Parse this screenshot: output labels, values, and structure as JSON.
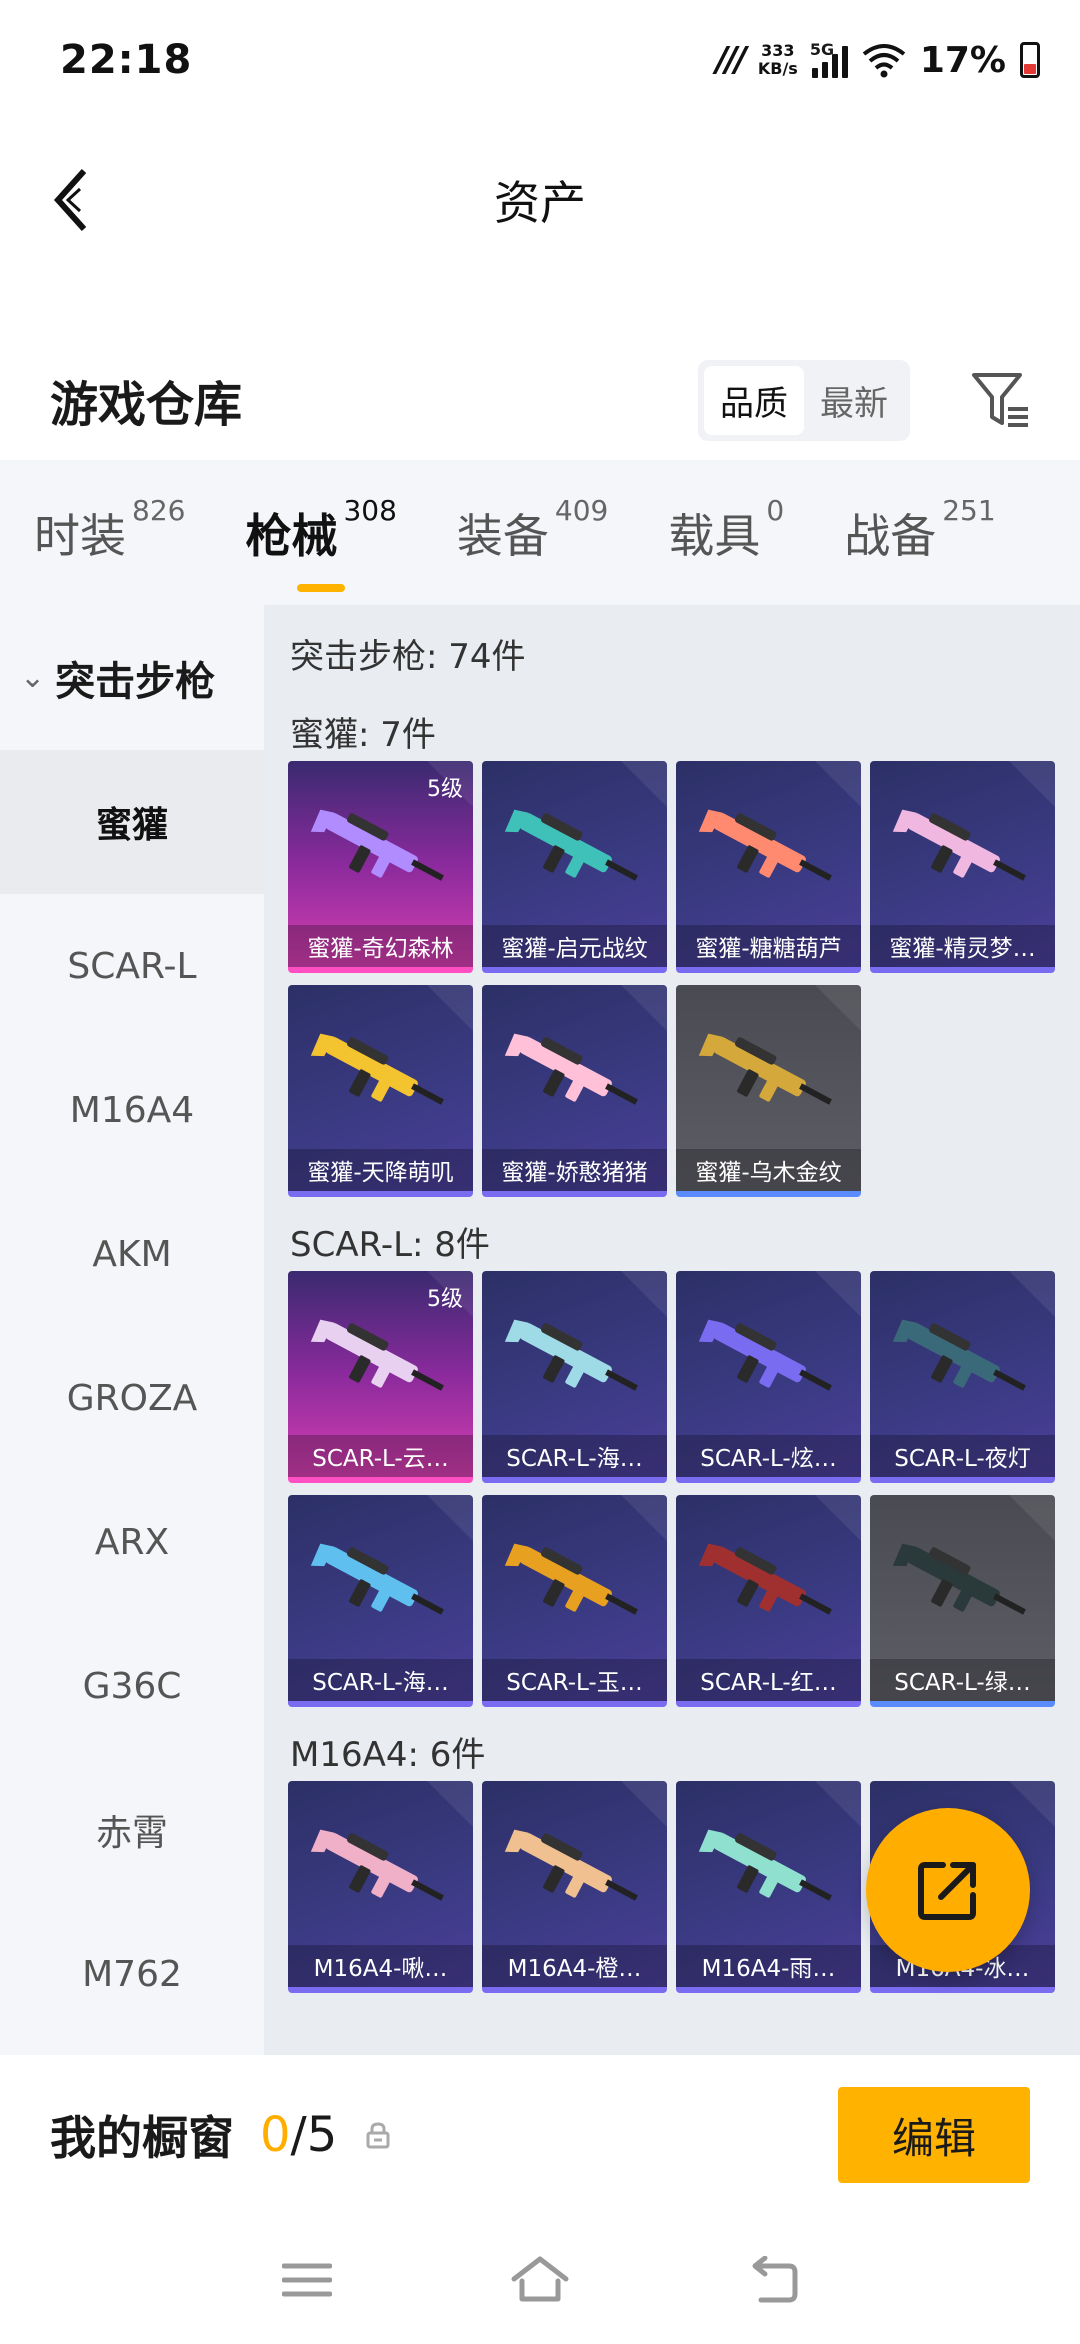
{
  "status_bar": {
    "time": "22:18",
    "net_speed_value": "333",
    "net_speed_unit": "KB/s",
    "network_type": "5G",
    "battery": "17%"
  },
  "header": {
    "title": "资产"
  },
  "warehouse": {
    "title": "游戏仓库",
    "sort_options": [
      "品质",
      "最新"
    ],
    "active_sort": "品质"
  },
  "category_tabs": [
    {
      "label": "时装",
      "count": "826"
    },
    {
      "label": "枪械",
      "count": "308"
    },
    {
      "label": "装备",
      "count": "409"
    },
    {
      "label": "载具",
      "count": "0"
    },
    {
      "label": "战备",
      "count": "251"
    }
  ],
  "sidebar": {
    "group": "突击步枪",
    "items": [
      "蜜獾",
      "SCAR-L",
      "M16A4",
      "AKM",
      "GROZA",
      "ARX",
      "G36C",
      "赤霄",
      "M762"
    ]
  },
  "main": {
    "total": "突击步枪: 74件",
    "sections": [
      {
        "title": "蜜獾: 7件",
        "items": [
          {
            "name": "蜜獾-奇幻森林",
            "level": "5级",
            "rarity": "pink",
            "color": "#b08cff"
          },
          {
            "name": "蜜獾-启元战纹",
            "level": "",
            "rarity": "purple",
            "color": "#3fc0b8"
          },
          {
            "name": "蜜獾-糖糖葫芦",
            "level": "",
            "rarity": "purple",
            "color": "#ff8a70"
          },
          {
            "name": "蜜獾-精灵梦…",
            "level": "",
            "rarity": "purple",
            "color": "#f0b8e0"
          },
          {
            "name": "蜜獾-天降萌叽",
            "level": "",
            "rarity": "purple",
            "color": "#f4c430"
          },
          {
            "name": "蜜獾-娇憨猪猪",
            "level": "",
            "rarity": "purple",
            "color": "#ffc0d8"
          },
          {
            "name": "蜜獾-乌木金纹",
            "level": "",
            "rarity": "grey",
            "color": "#d4a83a"
          }
        ]
      },
      {
        "title": "SCAR-L: 8件",
        "items": [
          {
            "name": "SCAR-L-云…",
            "level": "5级",
            "rarity": "pink",
            "color": "#e8d0f0"
          },
          {
            "name": "SCAR-L-海…",
            "level": "",
            "rarity": "purple",
            "color": "#9fdbe6"
          },
          {
            "name": "SCAR-L-炫…",
            "level": "",
            "rarity": "purple",
            "color": "#7a6cf0"
          },
          {
            "name": "SCAR-L-夜灯",
            "level": "",
            "rarity": "purple",
            "color": "#3a6a7a"
          },
          {
            "name": "SCAR-L-海…",
            "level": "",
            "rarity": "purple",
            "color": "#5fc0f0"
          },
          {
            "name": "SCAR-L-玉…",
            "level": "",
            "rarity": "purple",
            "color": "#e8a020"
          },
          {
            "name": "SCAR-L-红…",
            "level": "",
            "rarity": "purple",
            "color": "#a03030"
          },
          {
            "name": "SCAR-L-绿…",
            "level": "",
            "rarity": "grey",
            "color": "#2a3a3a"
          }
        ]
      },
      {
        "title": "M16A4: 6件",
        "items": [
          {
            "name": "M16A4-啾…",
            "level": "",
            "rarity": "purple",
            "color": "#f0b0c8"
          },
          {
            "name": "M16A4-橙…",
            "level": "",
            "rarity": "purple",
            "color": "#f0c090"
          },
          {
            "name": "M16A4-雨…",
            "level": "",
            "rarity": "purple",
            "color": "#90e0d0"
          },
          {
            "name": "M16A4-冰…",
            "level": "",
            "rarity": "purple",
            "color": "#3a80ff"
          }
        ]
      }
    ]
  },
  "showcase": {
    "label": "我的橱窗",
    "current": "0",
    "total": "/5",
    "edit_label": "编辑"
  },
  "colors": {
    "accent": "#ffb300",
    "sidebar_bg": "#f4f6f9",
    "main_bg": "#e9ecf1"
  },
  "icons": {
    "back": "back-arrow-icon",
    "filter": "filter-icon",
    "share": "share-icon",
    "lock": "lock-icon",
    "nav_menu": "menu-icon",
    "nav_home": "home-icon",
    "nav_back": "back-icon"
  }
}
